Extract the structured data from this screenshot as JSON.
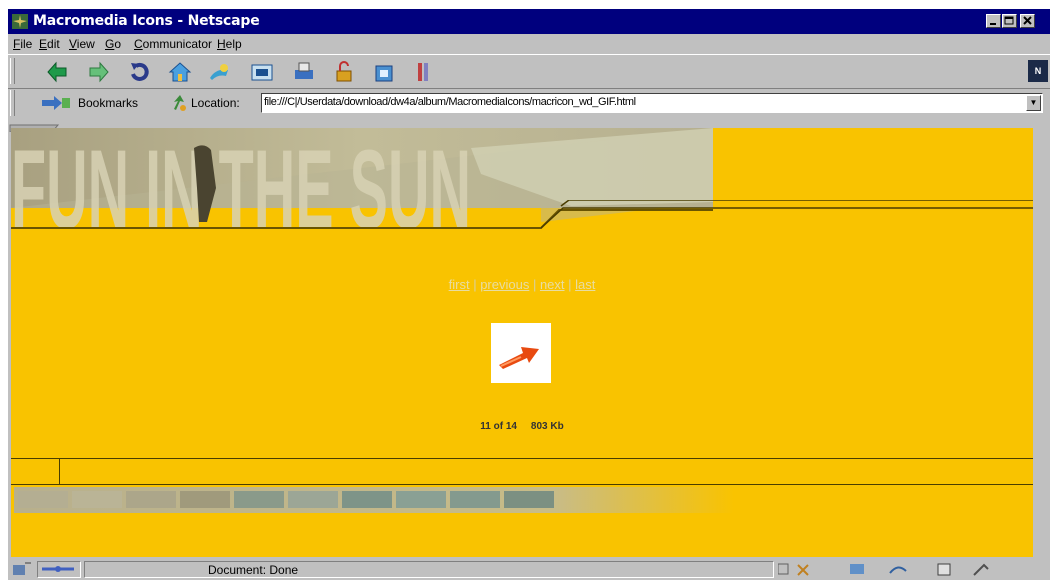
{
  "window": {
    "title": "Macromedia Icons - Netscape"
  },
  "menu": [
    "File",
    "Edit",
    "View",
    "Go",
    "Communicator",
    "Help"
  ],
  "menu_underlines": [
    "F",
    "E",
    "V",
    "G",
    "C",
    "H"
  ],
  "navigation_toolbar": {
    "buttons": [
      "back-icon",
      "forward-icon",
      "reload-icon",
      "home-icon",
      "search-icon",
      "netscape-guide-icon",
      "print-icon",
      "security-icon",
      "shop-icon",
      "stop-icon"
    ]
  },
  "location_toolbar": {
    "bookmarks_label": "Bookmarks",
    "location_label": "Location:",
    "url": "file:///C|/Userdata/download/dw4a/album/MacromediaIcons/macricon_wd_GIF.html"
  },
  "page": {
    "banner_text": "FUN IN THE SUN",
    "nav_links": [
      "first",
      "previous",
      "next",
      "last"
    ],
    "counter": "11 of 14",
    "file_size": "803 Kb"
  },
  "status": {
    "text": "Document: Done"
  },
  "colors": {
    "page_background": "#f9c300",
    "titlebar": "#00007e",
    "chrome": "#c0c0c0"
  }
}
